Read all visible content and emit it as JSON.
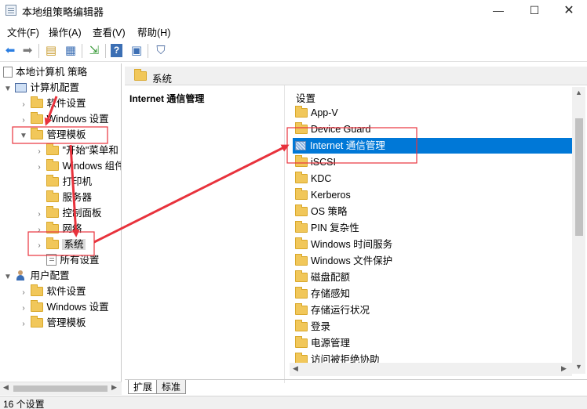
{
  "window": {
    "title": "本地组策略编辑器",
    "min_glyph": "—",
    "max_glyph": "☐",
    "close_glyph": "✕"
  },
  "menu": [
    "文件(F)",
    "操作(A)",
    "查看(V)",
    "帮助(H)"
  ],
  "toolbar_icons": [
    "back-arrow-icon",
    "forward-arrow-icon",
    "up-folder-icon",
    "show-hide-tree-icon",
    "export-list-icon",
    "help-icon",
    "properties-icon",
    "filter-icon"
  ],
  "tree": {
    "root": "本地计算机 策略",
    "computer_config": "计算机配置",
    "software_settings": "软件设置",
    "windows_settings": "Windows 设置",
    "admin_templates": "管理模板",
    "start_menu": "\"开始\"菜单和",
    "windows_components": "Windows 组件",
    "printers": "打印机",
    "servers": "服务器",
    "control_panel": "控制面板",
    "network": "网络",
    "system": "系统",
    "all_settings": "所有设置",
    "user_config": "用户配置",
    "user_software_settings": "软件设置",
    "user_windows_settings": "Windows 设置",
    "user_admin_templates": "管理模板"
  },
  "right": {
    "header_title": "系统",
    "description_title": "Internet 通信管理",
    "column_header": "设置",
    "items": [
      "App-V",
      "Device Guard",
      "Internet 通信管理",
      "iSCSI",
      "KDC",
      "Kerberos",
      "OS 策略",
      "PIN 复杂性",
      "Windows 时间服务",
      "Windows 文件保护",
      "磁盘配额",
      "存储感知",
      "存储运行状况",
      "登录",
      "电源管理",
      "访问被拒绝协助"
    ]
  },
  "tabs": [
    "扩展",
    "标准"
  ],
  "status": "16 个设置",
  "colors": {
    "selection": "#0078d7",
    "annotation": "#e8323c",
    "folder": "#f1c75a"
  }
}
